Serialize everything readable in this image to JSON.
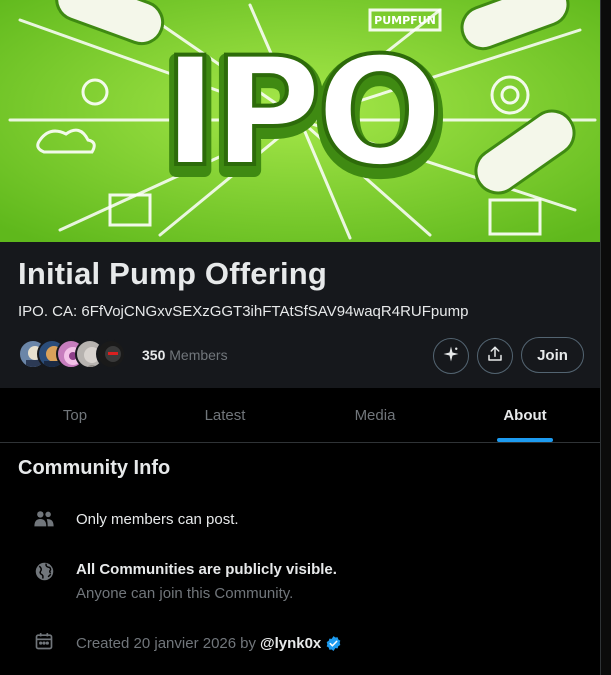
{
  "banner": {
    "headline": "IPO",
    "sign_text": "PUMPFUN"
  },
  "community": {
    "title": "Initial Pump Offering",
    "description": "IPO. CA: 6FfVojCNGxvSEXzGGT3ihFTAtSfSAV94waqR4RUFpump",
    "member_count": "350",
    "members_label": "Members",
    "join_label": "Join"
  },
  "tabs": [
    {
      "label": "Top",
      "active": false
    },
    {
      "label": "Latest",
      "active": false
    },
    {
      "label": "Media",
      "active": false
    },
    {
      "label": "About",
      "active": true
    }
  ],
  "info": {
    "title": "Community Info",
    "post_rule": "Only members can post.",
    "visibility_title": "All Communities are publicly visible.",
    "visibility_sub": "Anyone can join this Community.",
    "created_prefix": "Created 20 janvier 2026",
    "created_by": "by",
    "creator_handle": "@lynk0x"
  },
  "colors": {
    "accent": "#1d9bf0",
    "banner_green": "#7bd12a",
    "muted_text": "#71767b"
  },
  "icons": [
    "sparkle-icon",
    "share-icon",
    "people-icon",
    "globe-icon",
    "calendar-icon",
    "verified-badge-icon"
  ]
}
